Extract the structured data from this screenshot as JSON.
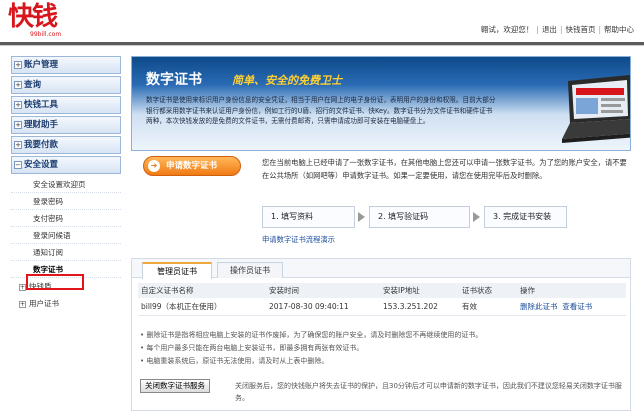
{
  "header": {
    "logo_text": "快钱",
    "logo_sub": "99bill.com",
    "user_greeting": "翱试，欢迎您！",
    "links": [
      "退出",
      "快钱首页",
      "帮助中心"
    ]
  },
  "sidebar": {
    "sections": [
      {
        "label": "账户管理",
        "expanded": false
      },
      {
        "label": "查询",
        "expanded": false
      },
      {
        "label": "快钱工具",
        "expanded": false
      },
      {
        "label": "理财助手",
        "expanded": false
      },
      {
        "label": "我要付款",
        "expanded": false
      },
      {
        "label": "安全设置",
        "expanded": true
      }
    ],
    "security_items": [
      "安全设置欢迎页",
      "登录密码",
      "支付密码",
      "登录问候语",
      "通知订阅",
      "数字证书"
    ],
    "sub_sections": [
      "快钱盾",
      "用户证书"
    ]
  },
  "banner": {
    "title": "数字证书",
    "slogan": "简单、安全的免费卫士",
    "description": "数字证书是使用来标识用户身份信息的安全凭证，相当于用户在网上的电子身份证，表明用户的身份和权限。目前大部分银行都采用数字证书来认证用户身份信，例如工行的U盾、招行的文件证书、快Key。数字证书分为文件证书和硬件证书两种，本次快钱发放的是免费的文件证书，无需付费邮寄，只需申请成功即可安装在电脑硬盘上。"
  },
  "apply_button": "申请数字证书",
  "intro": "您在当前电脑上已经申请了一张数字证书，在其他电脑上您还可以申请一张数字证书。为了您的账户安全，请不要在公共场所（如网吧等）申请数字证书。如果一定要使用，请您在使用完毕后及时删除。",
  "steps": [
    "1. 填写资料",
    "2. 填写验证码",
    "3. 完成证书安装"
  ],
  "flow_link": "申请数字证书流程演示",
  "tabs": [
    "管理员证书",
    "操作员证书"
  ],
  "table": {
    "headers": [
      "自定义证书名称",
      "安装时间",
      "安装IP地址",
      "证书状态",
      "操作"
    ],
    "rows": [
      {
        "name": "bill99（本机正在使用）",
        "time": "2017-08-30 09:40:11",
        "ip": "153.3.251.202",
        "status": "有效",
        "actions": [
          "删除此证书",
          "查看证书"
        ]
      }
    ]
  },
  "notes": [
    "• 删除证书是指将相应电脑上安装的证书作废掉，为了确保您的账户安全，请及时删除您不再继续使用的证书。",
    "• 每个用户最多只能在两台电脑上安装证书，即最多拥有两张有效证书。",
    "• 电脑重装系统后，原证书无法使用，请及时从上表中删除。"
  ],
  "close_button": "关闭数字证书服务",
  "close_desc": "关闭服务后，您的快钱账户将失去证书的保护，且30分钟后才可以申请新的数字证书，因此我们不建议您轻易关闭数字证书服务。"
}
